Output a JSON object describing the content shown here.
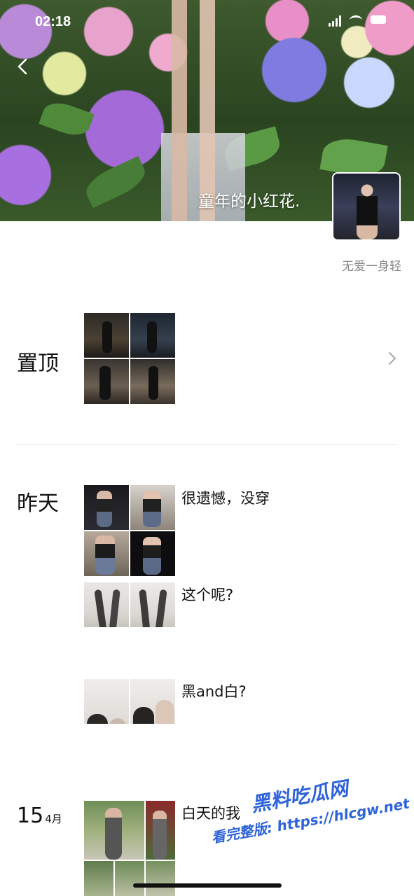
{
  "status_bar": {
    "time": "02:18"
  },
  "cover": {
    "title": "童年的小红花."
  },
  "profile": {
    "username": "无爱一身轻"
  },
  "pinned": {
    "label": "置顶"
  },
  "posts": [
    {
      "date": "昨天",
      "caption": "很遗憾，没穿"
    },
    {
      "caption": "这个呢?"
    },
    {
      "caption": "黑and白?"
    },
    {
      "day": "15",
      "month": "4月",
      "caption": "白天的我"
    }
  ],
  "watermark": {
    "line1": "黑料吃瓜网",
    "line2": "看完整版: https://hlcgw.net"
  }
}
